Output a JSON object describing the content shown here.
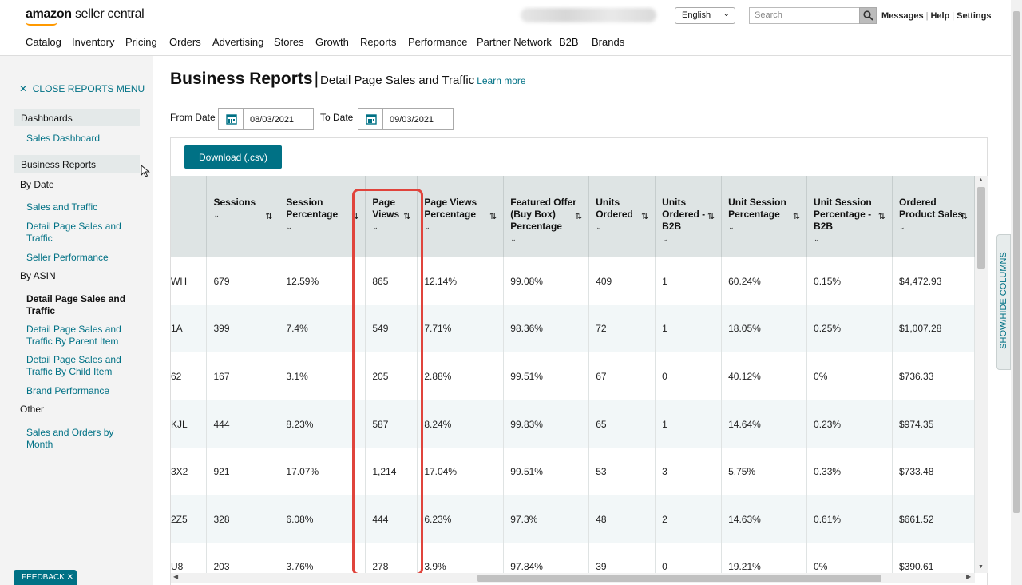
{
  "header": {
    "logo_brand": "amazon",
    "logo_product": "seller central",
    "language": "English",
    "search_placeholder": "Search",
    "links": [
      "Messages",
      "Help",
      "Settings"
    ]
  },
  "nav": [
    "Catalog",
    "Inventory",
    "Pricing",
    "Orders",
    "Advertising",
    "Stores",
    "Growth",
    "Reports",
    "Performance",
    "Partner Network",
    "B2B",
    "Brands"
  ],
  "sidebar": {
    "close_label": "CLOSE REPORTS MENU",
    "dashboards": "Dashboards",
    "sales_dashboard": "Sales Dashboard",
    "business_reports": "Business Reports",
    "by_date": "By Date",
    "by_date_items": [
      "Sales and Traffic",
      "Detail Page Sales and Traffic",
      "Seller Performance"
    ],
    "by_asin": "By ASIN",
    "by_asin_items": [
      "Detail Page Sales and Traffic",
      "Detail Page Sales and Traffic By Parent Item",
      "Detail Page Sales and Traffic By Child Item",
      "Brand Performance"
    ],
    "other": "Other",
    "other_items": [
      "Sales and Orders by Month"
    ],
    "feedback": "FEEDBACK ✕"
  },
  "main": {
    "title": "Business Reports",
    "separator": "|",
    "subtitle": "Detail Page Sales and Traffic",
    "learn_more": "Learn more",
    "from_label": "From Date",
    "from_value": "08/03/2021",
    "to_label": "To Date",
    "to_value": "09/03/2021",
    "download": "Download (.csv)",
    "show_hide": "SHOW/HIDE COLUMNS"
  },
  "table": {
    "columns": [
      "Sessions",
      "Session Percentage",
      "Page Views",
      "Page Views Percentage",
      "Featured Offer (Buy Box) Percentage",
      "Units Ordered",
      "Units Ordered - B2B",
      "Unit Session Percentage",
      "Unit Session Percentage - B2B",
      "Ordered Product Sales"
    ],
    "rows": [
      {
        "asin": "WH",
        "cells": [
          "679",
          "12.59%",
          "865",
          "12.14%",
          "99.08%",
          "409",
          "1",
          "60.24%",
          "0.15%",
          "$4,472.93"
        ]
      },
      {
        "asin": "1A",
        "cells": [
          "399",
          "7.4%",
          "549",
          "7.71%",
          "98.36%",
          "72",
          "1",
          "18.05%",
          "0.25%",
          "$1,007.28"
        ]
      },
      {
        "asin": "62",
        "cells": [
          "167",
          "3.1%",
          "205",
          "2.88%",
          "99.51%",
          "67",
          "0",
          "40.12%",
          "0%",
          "$736.33"
        ]
      },
      {
        "asin": "KJL",
        "cells": [
          "444",
          "8.23%",
          "587",
          "8.24%",
          "99.83%",
          "65",
          "1",
          "14.64%",
          "0.23%",
          "$974.35"
        ]
      },
      {
        "asin": "3X2",
        "cells": [
          "921",
          "17.07%",
          "1,214",
          "17.04%",
          "99.51%",
          "53",
          "3",
          "5.75%",
          "0.33%",
          "$733.48"
        ]
      },
      {
        "asin": "2Z5",
        "cells": [
          "328",
          "6.08%",
          "444",
          "6.23%",
          "97.3%",
          "48",
          "2",
          "14.63%",
          "0.61%",
          "$661.52"
        ]
      },
      {
        "asin": "U8",
        "cells": [
          "203",
          "3.76%",
          "278",
          "3.9%",
          "97.84%",
          "39",
          "0",
          "19.21%",
          "0%",
          "$390.61"
        ]
      }
    ]
  },
  "colors": {
    "accent": "#007185",
    "highlight": "#e0443c",
    "header_bg": "#dee4e4",
    "logo_orange": "#ff9900"
  }
}
